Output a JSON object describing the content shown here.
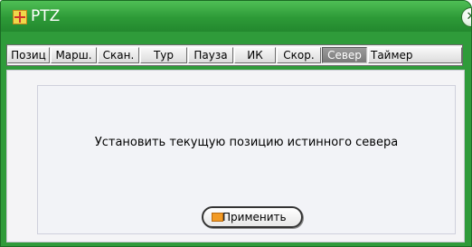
{
  "window": {
    "title": "PTZ",
    "close_symbol": "✕",
    "accent_color": "#2f9b3a"
  },
  "tabs": [
    {
      "label": "Позиц",
      "active": false
    },
    {
      "label": "Марш.",
      "active": false
    },
    {
      "label": "Скан.",
      "active": false
    },
    {
      "label": "Тур",
      "active": false
    },
    {
      "label": "Пауза",
      "active": false
    },
    {
      "label": "ИК",
      "active": false
    },
    {
      "label": "Скор.",
      "active": false
    },
    {
      "label": "Север",
      "active": true
    },
    {
      "label": "Таймер",
      "active": false
    }
  ],
  "north": {
    "message": "Установить текущую позицию истинного севера",
    "apply_label": "Применить"
  },
  "icons": {
    "title_icon": "ptz-app-icon",
    "close_icon": "close-icon",
    "apply_icon": "apply-icon"
  }
}
